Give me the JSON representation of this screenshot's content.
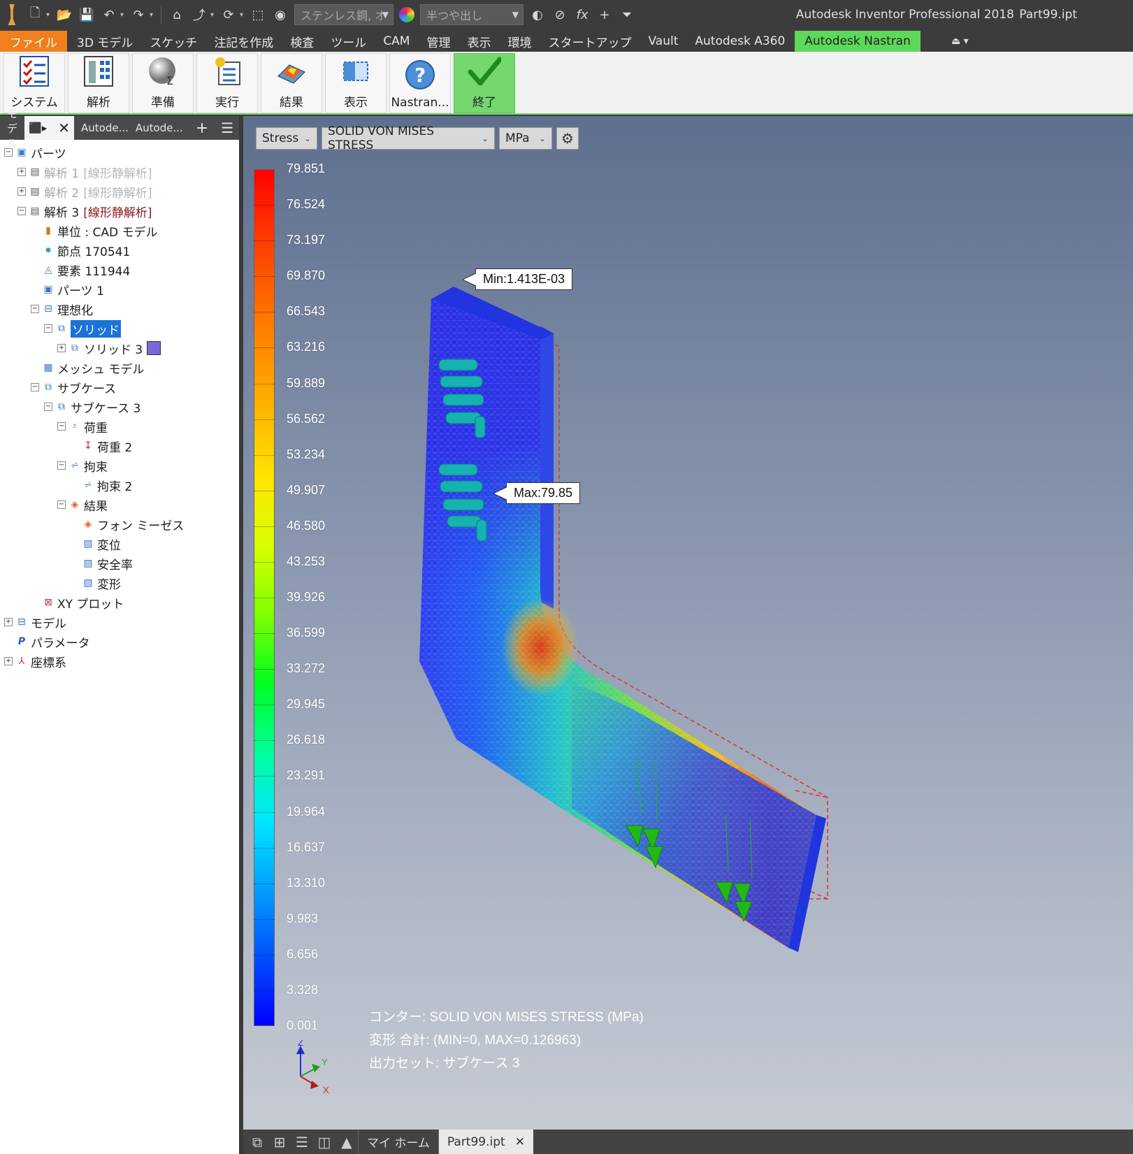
{
  "app": {
    "title": "Autodesk Inventor Professional 2018",
    "file": "Part99.ipt",
    "logo_text": "PRO"
  },
  "quick_access": {
    "material": "ステンレス鋼, オ",
    "appearance": "半つや出し"
  },
  "ribbon_tabs": [
    "ファイル",
    "3D モデル",
    "スケッチ",
    "注記を作成",
    "検査",
    "ツール",
    "CAM",
    "管理",
    "表示",
    "環境",
    "スタートアップ",
    "Vault",
    "Autodesk A360",
    "Autodesk Nastran"
  ],
  "ribbon_tabs_active": "Autodesk Nastran",
  "ribbon": {
    "buttons": [
      {
        "label": "システム",
        "icon": "checklist-icon"
      },
      {
        "label": "解析",
        "icon": "analysis-icon"
      },
      {
        "label": "準備",
        "icon": "sphere-icon"
      },
      {
        "label": "実行",
        "icon": "run-icon"
      },
      {
        "label": "結果",
        "icon": "results-icon"
      },
      {
        "label": "表示",
        "icon": "display-icon"
      },
      {
        "label": "Nastran...",
        "icon": "help-icon"
      },
      {
        "label": "終了",
        "icon": "checkmark-icon"
      }
    ]
  },
  "browser": {
    "tabs": {
      "model": "モデル",
      "tab3": "Autode...",
      "tab4": "Autode..."
    },
    "tree": [
      {
        "indent": 0,
        "exp": "−",
        "icon": "part-icon",
        "label": "パーツ",
        "tag": ""
      },
      {
        "indent": 1,
        "exp": "+",
        "icon": "analysis-icon",
        "label": "解析 1",
        "tag": "[線形静解析]",
        "dim": true
      },
      {
        "indent": 1,
        "exp": "+",
        "icon": "analysis-icon",
        "label": "解析 2",
        "tag": "[線形静解析]",
        "dim": true
      },
      {
        "indent": 1,
        "exp": "−",
        "icon": "analysis-icon",
        "label": "解析 3",
        "tag": "[線形静解析]"
      },
      {
        "indent": 2,
        "exp": "",
        "icon": "units-icon",
        "label": "単位 : CAD モデル",
        "tag": ""
      },
      {
        "indent": 2,
        "exp": "",
        "icon": "node-icon",
        "label": "節点 170541",
        "tag": ""
      },
      {
        "indent": 2,
        "exp": "",
        "icon": "element-icon",
        "label": "要素 111944",
        "tag": ""
      },
      {
        "indent": 2,
        "exp": "",
        "icon": "part-icon",
        "label": "パーツ 1",
        "tag": ""
      },
      {
        "indent": 2,
        "exp": "−",
        "icon": "idealization-icon",
        "label": "理想化",
        "tag": ""
      },
      {
        "indent": 3,
        "exp": "−",
        "icon": "solid-icon",
        "label": "ソリッド",
        "tag": "",
        "selected": true
      },
      {
        "indent": 4,
        "exp": "+",
        "icon": "solid-icon",
        "label": "ソリッド 3",
        "tag": "",
        "swatch": true
      },
      {
        "indent": 2,
        "exp": "",
        "icon": "mesh-icon",
        "label": "メッシュ モデル",
        "tag": ""
      },
      {
        "indent": 2,
        "exp": "−",
        "icon": "subcase-icon",
        "label": "サブケース",
        "tag": ""
      },
      {
        "indent": 3,
        "exp": "−",
        "icon": "subcase-icon",
        "label": "サブケース 3",
        "tag": ""
      },
      {
        "indent": 4,
        "exp": "−",
        "icon": "load-icon",
        "label": "荷重",
        "tag": ""
      },
      {
        "indent": 5,
        "exp": "",
        "icon": "load-arrow-icon",
        "label": "荷重 2",
        "tag": ""
      },
      {
        "indent": 4,
        "exp": "−",
        "icon": "constraint-icon",
        "label": "拘束",
        "tag": ""
      },
      {
        "indent": 5,
        "exp": "",
        "icon": "constraint-icon",
        "label": "拘束 2",
        "tag": ""
      },
      {
        "indent": 4,
        "exp": "−",
        "icon": "results-icon",
        "label": "結果",
        "tag": ""
      },
      {
        "indent": 5,
        "exp": "",
        "icon": "results-icon",
        "label": "フォン ミーゼス",
        "tag": ""
      },
      {
        "indent": 5,
        "exp": "",
        "icon": "result-plot-icon",
        "label": "変位",
        "tag": ""
      },
      {
        "indent": 5,
        "exp": "",
        "icon": "result-plot-icon",
        "label": "安全率",
        "tag": ""
      },
      {
        "indent": 5,
        "exp": "",
        "icon": "result-plot-icon",
        "label": "変形",
        "tag": ""
      },
      {
        "indent": 2,
        "exp": "",
        "icon": "xy-plot-icon",
        "label": "XY プロット",
        "tag": ""
      },
      {
        "indent": 0,
        "exp": "+",
        "icon": "model-tree-icon",
        "label": "モデル",
        "tag": ""
      },
      {
        "indent": 0,
        "exp": "",
        "icon": "parameter-icon",
        "label": "パラメータ",
        "tag": ""
      },
      {
        "indent": 0,
        "exp": "+",
        "icon": "coordinate-icon",
        "label": "座標系",
        "tag": ""
      }
    ]
  },
  "result_toolbar": {
    "type": "Stress",
    "component": "SOLID VON MISES STRESS",
    "unit": "MPa"
  },
  "legend": {
    "values": [
      "79.851",
      "76.524",
      "73.197",
      "69.870",
      "66.543",
      "63.216",
      "59.889",
      "56.562",
      "53.234",
      "49.907",
      "46.580",
      "43.253",
      "39.926",
      "36.599",
      "33.272",
      "29.945",
      "26.618",
      "23.291",
      "19.964",
      "16.637",
      "13.310",
      "9.983",
      "6.656",
      "3.328",
      "0.001"
    ]
  },
  "callouts": {
    "min": "Min:1.413E-03",
    "max": "Max:79.85"
  },
  "triad": {
    "z": "Z",
    "y": "Y",
    "x": "X"
  },
  "info": {
    "line1": "コンター: SOLID VON MISES STRESS (MPa)",
    "line2": "変形 合計: (MIN=0, MAX=0.126963)",
    "line3": "出力セット: サブケース 3"
  },
  "doc_tabs": {
    "home": "マイ ホーム",
    "file": "Part99.ipt"
  }
}
